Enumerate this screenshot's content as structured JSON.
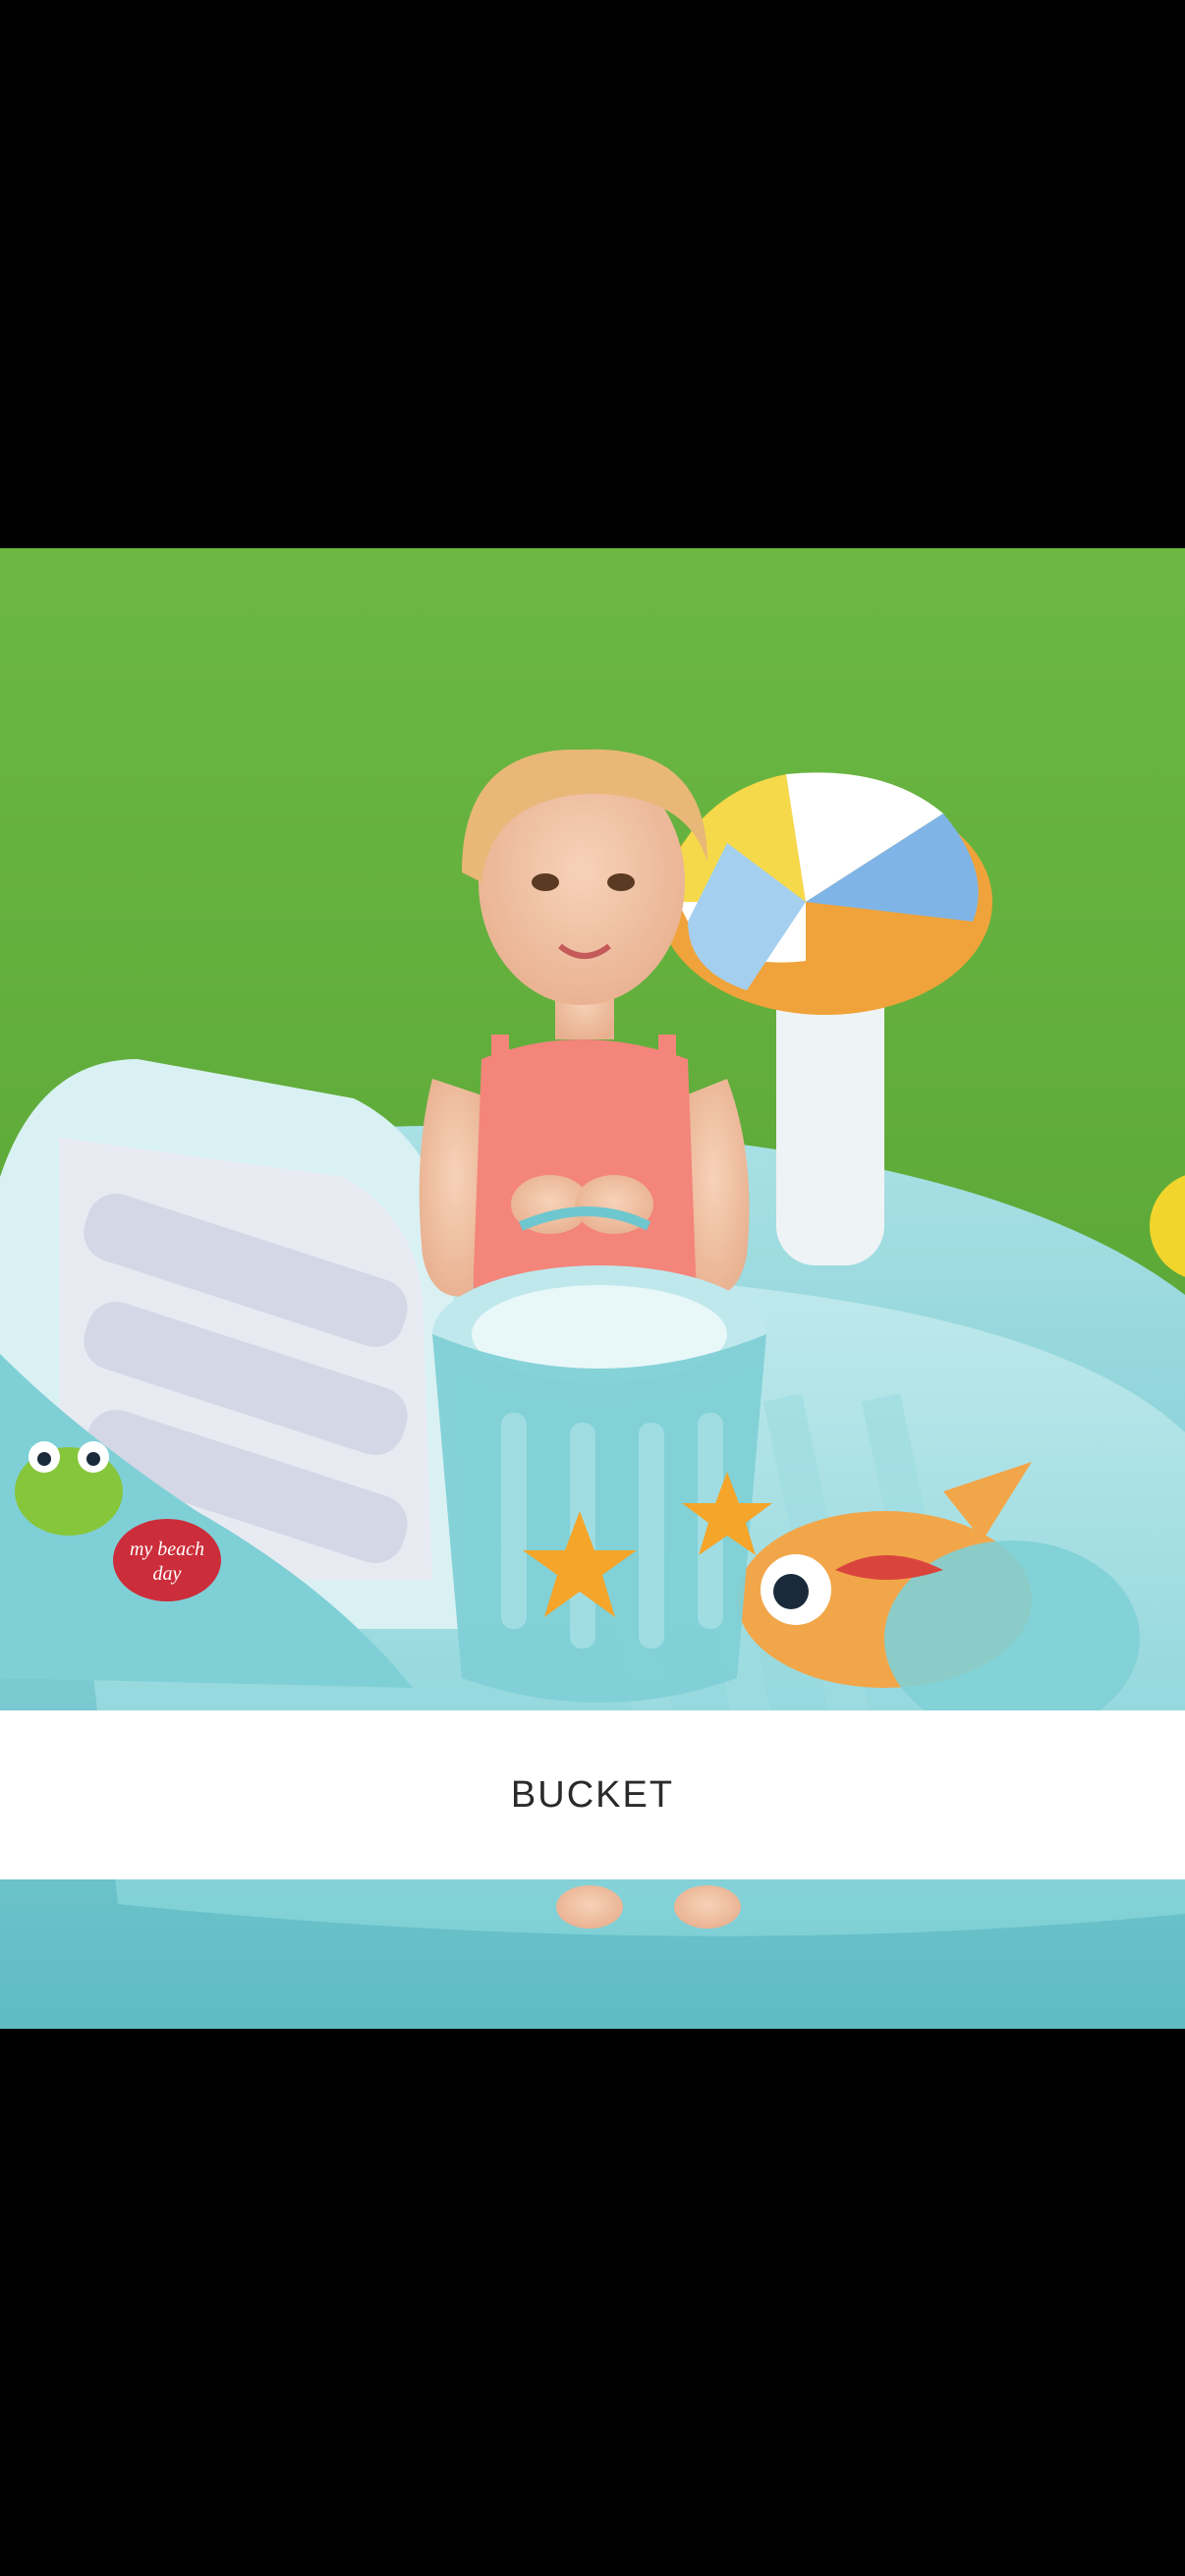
{
  "viewer": {
    "background_color": "#000000",
    "caption": "BUCKET",
    "caption_background": "#ffffff"
  },
  "photo": {
    "subject_icon": "product-photo",
    "decal_text": "my beach day"
  }
}
